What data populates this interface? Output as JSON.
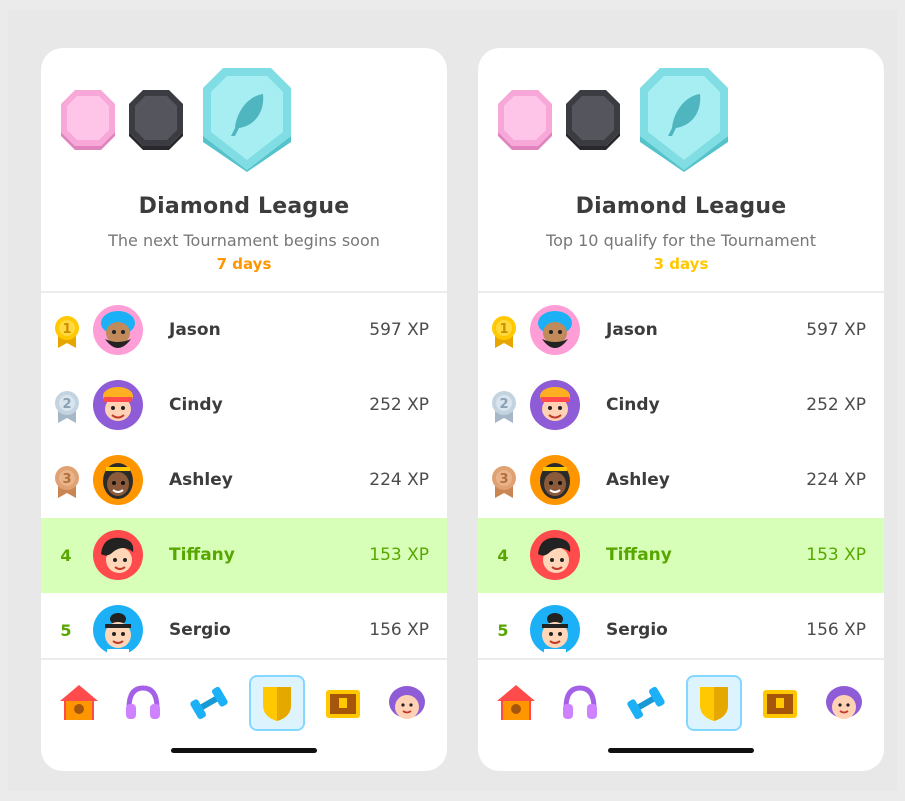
{
  "colors": {
    "pink_badge": "#f9a8d4",
    "dark_badge": "#4b4b52",
    "diamond_badge": "#8ee6ea",
    "highlight_row": "#d7ffb8",
    "highlight_text": "#58a700",
    "days_orange": "#ff9600",
    "days_yellow": "#ffc800"
  },
  "screens": [
    {
      "league_title": "Diamond League",
      "subtitle": "The next Tournament begins soon",
      "days": "7 days",
      "days_color": "#ff9600",
      "rows": [
        {
          "rank": "1",
          "name": "Jason",
          "xp": "597 XP"
        },
        {
          "rank": "2",
          "name": "Cindy",
          "xp": "252 XP"
        },
        {
          "rank": "3",
          "name": "Ashley",
          "xp": "224 XP"
        },
        {
          "rank": "4",
          "name": "Tiffany",
          "xp": "153 XP"
        },
        {
          "rank": "5",
          "name": "Sergio",
          "xp": "156 XP"
        }
      ]
    },
    {
      "league_title": "Diamond League",
      "subtitle": "Top 10 qualify for the Tournament",
      "days": "3 days",
      "days_color": "#ffc800",
      "rows": [
        {
          "rank": "1",
          "name": "Jason",
          "xp": "597 XP"
        },
        {
          "rank": "2",
          "name": "Cindy",
          "xp": "252 XP"
        },
        {
          "rank": "3",
          "name": "Ashley",
          "xp": "224 XP"
        },
        {
          "rank": "4",
          "name": "Tiffany",
          "xp": "153 XP"
        },
        {
          "rank": "5",
          "name": "Sergio",
          "xp": "156 XP"
        }
      ]
    }
  ],
  "tabs": [
    {
      "icon": "home-icon"
    },
    {
      "icon": "headphones-icon"
    },
    {
      "icon": "dumbbell-icon"
    },
    {
      "icon": "shield-icon",
      "active": true
    },
    {
      "icon": "treasure-chest-icon"
    },
    {
      "icon": "profile-avatar-icon"
    }
  ]
}
